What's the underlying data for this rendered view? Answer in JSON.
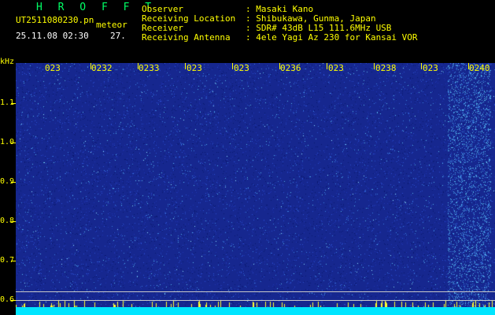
{
  "header": {
    "brand": "H R O F F T",
    "filename": "UT2511080230.pn",
    "meteor_label": "meteor",
    "datetime": "25.11.08 02:30",
    "count": "27.",
    "fields": [
      {
        "label": "Observer",
        "value": ": Masaki Kano"
      },
      {
        "label": "Receiving Location",
        "value": ": Shibukawa, Gunma, Japan"
      },
      {
        "label": "Receiver",
        "value": ": SDR# 43dB L15 111.6MHz USB"
      },
      {
        "label": "Receiving Antenna",
        "value": ": 4ele Yagi Az 230 for Kansai VOR"
      }
    ]
  },
  "y_axis": {
    "unit": "kHz",
    "labels": [
      "1.1",
      "1.0",
      "0.9",
      "0.8",
      "0.7",
      "0.6"
    ]
  },
  "time_axis": {
    "labels": [
      "023",
      "0232",
      "0233",
      "023",
      "023",
      "0236",
      "023",
      "0238",
      "023",
      "0240"
    ]
  },
  "colors": {
    "background": "#000000",
    "spectrogram": "#16278f",
    "axis_text": "#ffff00",
    "brand": "#00ff66",
    "noise_strip": "#00e5ff"
  }
}
